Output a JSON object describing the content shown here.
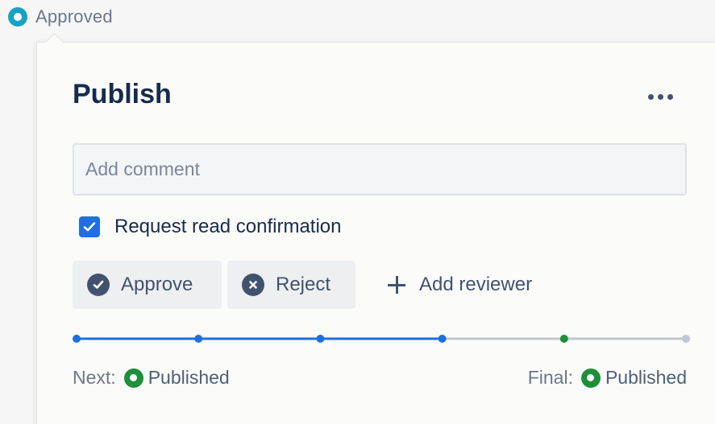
{
  "status": {
    "label": "Approved",
    "icon": "approved-status-icon",
    "color": "#17a2c4"
  },
  "panel": {
    "title": "Publish",
    "more_icon": "more-horizontal-icon"
  },
  "comment": {
    "placeholder": "Add comment",
    "value": ""
  },
  "read_confirmation": {
    "label": "Request read confirmation",
    "checked": true
  },
  "actions": {
    "approve_label": "Approve",
    "reject_label": "Reject",
    "add_reviewer_label": "Add reviewer"
  },
  "workflow": {
    "steps": [
      {
        "state": "done"
      },
      {
        "state": "done"
      },
      {
        "state": "done"
      },
      {
        "state": "current"
      },
      {
        "state": "next"
      },
      {
        "state": "pending"
      }
    ],
    "colors": {
      "done": "#1f6fe0",
      "next": "#1e8f3a",
      "pending": "#c1c7d0"
    },
    "next_prefix": "Next:",
    "next_state": "Published",
    "final_prefix": "Final:",
    "final_state": "Published"
  }
}
